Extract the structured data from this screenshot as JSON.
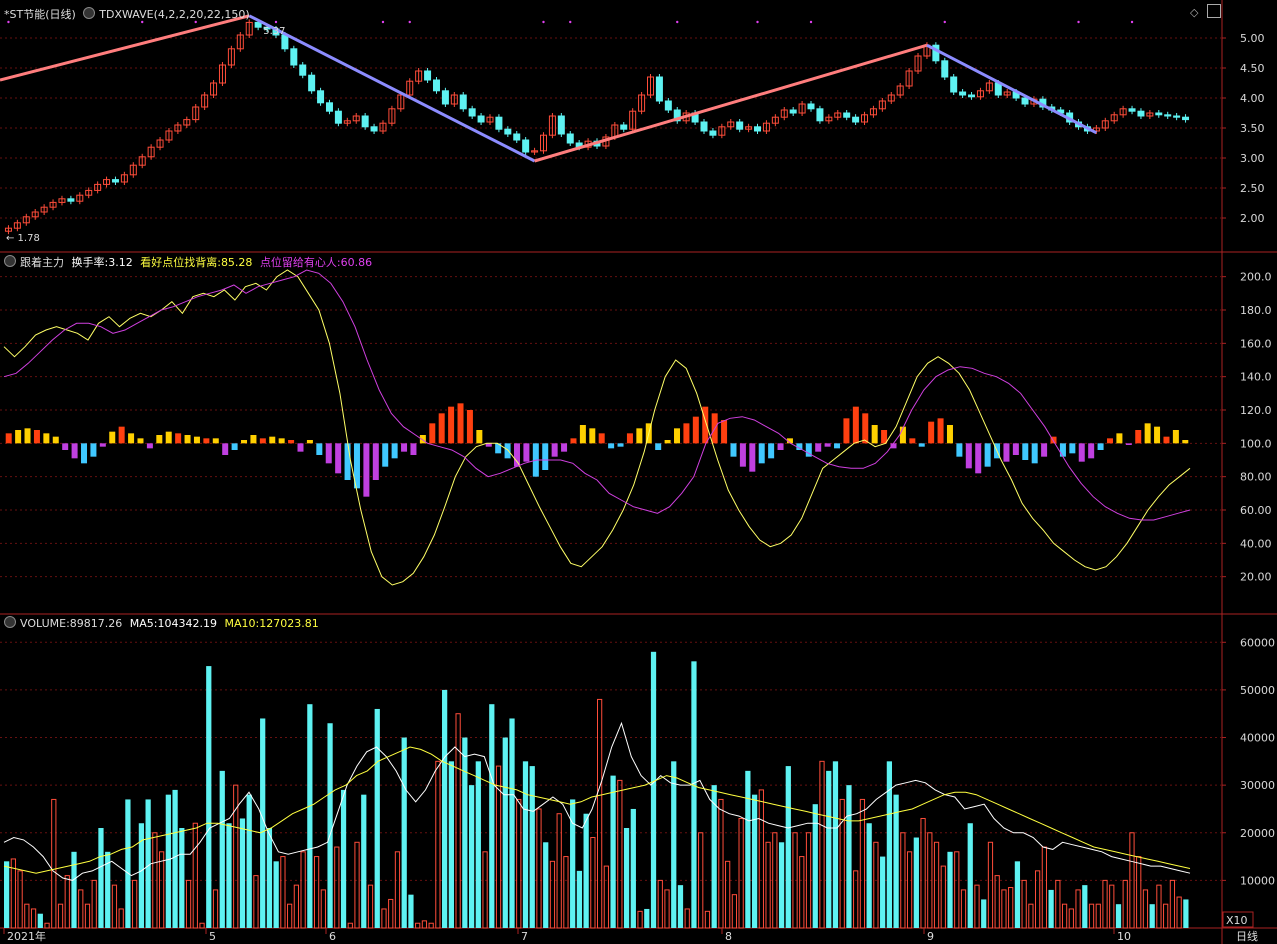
{
  "colors": {
    "up": "#ff4d3a",
    "down": "#5ef2f2",
    "ma5": "#ffffff",
    "ma10": "#ffff40",
    "wave_up": "#ff7d7d",
    "wave_down": "#8c8cff",
    "grid": "#661111",
    "frame": "#aa2222",
    "yellow_line": "#ffff66",
    "magenta_line": "#d040e0",
    "bar_orange": "#ff4010",
    "bar_yellow": "#ffd000",
    "bar_cyan": "#40c8ff",
    "bar_magenta": "#c040e0"
  },
  "panel1": {
    "title": "*ST节能(日线)",
    "indicator": "TDXWAVE(4,2,2,20,22,150)",
    "high_label": "5.37",
    "low_label": "1.78",
    "y_ticks": [
      "5.00",
      "4.50",
      "4.00",
      "3.50",
      "3.00",
      "2.50",
      "2.00"
    ]
  },
  "panel2": {
    "name": "跟着主力",
    "l1_name": "换手率:",
    "l1_value": "3.12",
    "l2_name": "看好点位找背离:",
    "l2_value": "85.28",
    "l3_name": "点位留给有心人:",
    "l3_value": "60.86",
    "y_ticks": [
      "200.0",
      "180.0",
      "160.0",
      "140.0",
      "120.0",
      "100.0",
      "80.00",
      "60.00",
      "40.00",
      "20.00"
    ]
  },
  "panel3": {
    "l1_name": "VOLUME:",
    "l1_value": "89817.26",
    "l2_name": "MA5:",
    "l2_value": "104342.19",
    "l3_name": "MA10:",
    "l3_value": "127023.81",
    "y_ticks": [
      "60000",
      "50000",
      "40000",
      "30000",
      "20000",
      "10000"
    ],
    "unit": "X10"
  },
  "x_labels": [
    "2021年",
    "5",
    "6",
    "7",
    "8",
    "9",
    "10"
  ],
  "period_label": "日线",
  "chart_data": [
    {
      "type": "candlestick",
      "title": "*ST节能(日线)",
      "ylim": [
        1.5,
        5.3
      ],
      "y_ticks": [
        2.0,
        2.5,
        3.0,
        3.5,
        4.0,
        4.5,
        5.0
      ],
      "wave_lines": [
        {
          "from": 1.78,
          "to": 5.37,
          "direction": "up"
        },
        {
          "from": 5.37,
          "to": 2.95,
          "direction": "down"
        },
        {
          "from": 2.95,
          "to": 4.88,
          "direction": "up"
        },
        {
          "from": 4.88,
          "to": 3.42,
          "direction": "down"
        }
      ],
      "annotations": [
        "5.37",
        "1.78"
      ],
      "close": [
        1.83,
        1.92,
        2.02,
        2.1,
        2.18,
        2.26,
        2.32,
        2.28,
        2.38,
        2.46,
        2.56,
        2.64,
        2.6,
        2.72,
        2.88,
        3.02,
        3.18,
        3.3,
        3.45,
        3.55,
        3.64,
        3.85,
        4.05,
        4.25,
        4.55,
        4.82,
        5.05,
        5.26,
        5.18,
        5.15,
        5.05,
        4.82,
        4.55,
        4.38,
        4.12,
        3.92,
        3.78,
        3.58,
        3.62,
        3.7,
        3.52,
        3.45,
        3.58,
        3.82,
        4.05,
        4.28,
        4.45,
        4.3,
        4.12,
        3.9,
        4.05,
        3.82,
        3.7,
        3.6,
        3.68,
        3.48,
        3.4,
        3.3,
        3.1,
        3.12,
        3.38,
        3.7,
        3.4,
        3.25,
        3.18,
        3.28,
        3.2,
        3.35,
        3.55,
        3.48,
        3.78,
        4.05,
        4.35,
        3.95,
        3.8,
        3.62,
        3.75,
        3.6,
        3.45,
        3.38,
        3.52,
        3.6,
        3.48,
        3.52,
        3.45,
        3.58,
        3.68,
        3.8,
        3.75,
        3.9,
        3.82,
        3.62,
        3.68,
        3.75,
        3.68,
        3.6,
        3.72,
        3.82,
        3.95,
        4.05,
        4.2,
        4.45,
        4.7,
        4.88,
        4.62,
        4.35,
        4.1,
        4.05,
        4.02,
        4.12,
        4.25,
        4.05,
        4.1,
        4.0,
        3.9,
        3.98,
        3.85,
        3.8,
        3.75,
        3.6,
        3.52,
        3.45,
        3.5,
        3.62,
        3.72,
        3.82,
        3.78,
        3.7,
        3.75,
        3.72,
        3.7,
        3.68,
        3.64
      ]
    },
    {
      "type": "bar",
      "title": "跟着主力",
      "ylim": [
        0,
        210
      ],
      "baseline": 100,
      "series": [
        {
          "name": "看好点位找背离",
          "values": [
            158,
            152,
            158,
            165,
            168,
            170,
            168,
            166,
            162,
            172,
            176,
            170,
            175,
            178,
            176,
            180,
            185,
            178,
            188,
            190,
            188,
            192,
            186,
            194,
            196,
            192,
            200,
            204,
            200,
            190,
            180,
            160,
            130,
            90,
            60,
            35,
            20,
            15,
            17,
            22,
            32,
            45,
            62,
            80,
            92,
            98,
            100,
            100,
            96,
            88,
            75,
            62,
            50,
            38,
            28,
            26,
            32,
            38,
            48,
            60,
            75,
            95,
            120,
            140,
            150,
            145,
            130,
            110,
            90,
            72,
            60,
            50,
            42,
            38,
            40,
            45,
            55,
            70,
            85,
            90,
            95,
            100,
            102,
            98,
            100,
            110,
            125,
            140,
            148,
            152,
            148,
            142,
            132,
            118,
            104,
            90,
            78,
            64,
            55,
            48,
            40,
            35,
            30,
            26,
            24,
            26,
            32,
            40,
            50,
            60,
            68,
            75,
            80,
            85
          ]
        },
        {
          "name": "点位留给有心人",
          "values": [
            140,
            142,
            148,
            155,
            162,
            168,
            172,
            172,
            170,
            166,
            168,
            172,
            176,
            180,
            182,
            185,
            188,
            190,
            192,
            195,
            190,
            194,
            196,
            198,
            200,
            204,
            202,
            196,
            185,
            170,
            150,
            132,
            118,
            110,
            105,
            100,
            98,
            96,
            92,
            85,
            80,
            82,
            85,
            88,
            90,
            90,
            90,
            88,
            82,
            78,
            70,
            66,
            62,
            60,
            58,
            62,
            70,
            80,
            100,
            112,
            115,
            116,
            114,
            110,
            106,
            100,
            96,
            92,
            88,
            86,
            85,
            85,
            88,
            95,
            105,
            120,
            132,
            140,
            144,
            146,
            145,
            142,
            140,
            136,
            130,
            120,
            110,
            98,
            86,
            76,
            68,
            62,
            58,
            55,
            54,
            54,
            56,
            58,
            60
          ]
        },
        {
          "name": "换手率",
          "values": [
            6,
            8,
            9,
            8,
            6,
            4,
            -4,
            -9,
            -12,
            -8,
            -2,
            7,
            10,
            6,
            3,
            -3,
            5,
            7,
            6,
            5,
            4,
            3,
            3,
            -7,
            -4,
            2,
            5,
            3,
            4,
            3,
            2,
            -5,
            2,
            -7,
            -12,
            -18,
            -22,
            -27,
            -32,
            -22,
            -14,
            -9,
            -5,
            -7,
            5,
            12,
            18,
            22,
            24,
            20,
            8,
            -2,
            -6,
            -9,
            -14,
            -11,
            -20,
            -16,
            -8,
            -5,
            3,
            11,
            9,
            6,
            -3,
            -2,
            6,
            9,
            12,
            -4,
            2,
            9,
            12,
            16,
            22,
            18,
            14,
            -8,
            -14,
            -17,
            -12,
            -9,
            -4,
            3,
            -4,
            -8,
            -5,
            -2,
            -3,
            15,
            22,
            18,
            11,
            8,
            -3,
            10,
            3,
            -2,
            13,
            15,
            11,
            -8,
            -15,
            -18,
            -14,
            -9,
            -11,
            -7,
            -10,
            -12,
            -8,
            4,
            -8,
            -6,
            -11,
            -9,
            -4,
            3,
            6,
            -1,
            8,
            12,
            10,
            4,
            8,
            2
          ]
        }
      ]
    },
    {
      "type": "bar",
      "title": "VOLUME",
      "ylim": [
        0,
        63000
      ],
      "series": [
        {
          "name": "VOLUME",
          "values": [
            14000,
            14500,
            12000,
            5000,
            4000,
            3000,
            1000,
            27000,
            5000,
            11000,
            16000,
            8000,
            5000,
            10000,
            21000,
            16000,
            9000,
            4000,
            27000,
            10000,
            22000,
            27000,
            20000,
            16000,
            28000,
            29000,
            21000,
            10000,
            22000,
            1000,
            55000,
            8000,
            33000,
            22000,
            30000,
            23000,
            28000,
            11000,
            44000,
            21000,
            14000,
            15000,
            5000,
            9000,
            16000,
            47000,
            15000,
            8000,
            43000,
            17000,
            29000,
            1000,
            18000,
            28000,
            9000,
            46000,
            4000,
            6000,
            16000,
            40000,
            7000,
            1000,
            1500,
            1000,
            35000,
            50000,
            35000,
            45000,
            40000,
            30000,
            35000,
            16000,
            47000,
            34000,
            40000,
            44000,
            27000,
            35000,
            34000,
            25000,
            18000,
            14000,
            24000,
            15000,
            27000,
            12000,
            24000,
            19000,
            48000,
            13000,
            32000,
            31000,
            21000,
            25000,
            3500,
            4000,
            58000,
            10000,
            8000,
            35000,
            9000,
            4000,
            56000,
            20000,
            3500,
            30000,
            27000,
            14000,
            7000,
            23000,
            33000,
            28000,
            29000,
            18000,
            20000,
            18000,
            34000,
            20000,
            15000,
            20000,
            26000,
            35000,
            33000,
            35000,
            27000,
            30000,
            12000,
            27000,
            22000,
            18000,
            15000,
            35000,
            28000,
            20000,
            16000,
            19000,
            23000,
            20000,
            18000,
            13000,
            16000,
            16000,
            8000,
            22000,
            9000,
            6000,
            18000,
            11000,
            8000,
            8500,
            14000,
            10000,
            5000,
            12000,
            17000,
            8000,
            10000,
            5000,
            4000,
            8000,
            9000,
            5000,
            5000,
            10000,
            9000,
            5000,
            10000,
            20000,
            15000,
            8000,
            5000,
            9000,
            5000,
            10000,
            6500,
            6000
          ]
        },
        {
          "name": "MA5",
          "values": [
            18000,
            19000,
            18500,
            17000,
            15000,
            12000,
            10500,
            10000,
            11500,
            12000,
            13000,
            14000,
            12500,
            11000,
            12000,
            13500,
            14000,
            14500,
            15500,
            15500,
            18000,
            21000,
            22000,
            23000,
            26000,
            28500,
            25000,
            20000,
            16000,
            15500,
            16000,
            16500,
            17000,
            18000,
            24000,
            30000,
            34000,
            37000,
            38000,
            36000,
            33000,
            29000,
            26500,
            29000,
            33000,
            36000,
            38000,
            36000,
            36500,
            36000,
            30000,
            28000,
            28000,
            25000,
            24500,
            26000,
            27500,
            26000,
            22000,
            21000,
            25000,
            31000,
            38000,
            43000,
            36000,
            32000,
            30000,
            32000,
            30500,
            30000,
            30000,
            31000,
            27000,
            25000,
            24000,
            23500,
            22500,
            23000,
            22000,
            21500,
            21000,
            21500,
            22000,
            22000,
            21000,
            21000,
            23500,
            24000,
            25000,
            27000,
            28500,
            30000,
            30500,
            31000,
            30500,
            29000,
            28000,
            27500,
            25000,
            25500,
            26000,
            23000,
            21000,
            20000,
            20000,
            19000,
            17000,
            16500,
            18000,
            17500,
            17000,
            16500,
            16000,
            15000,
            14500,
            14000,
            13500,
            13000,
            13000,
            12500,
            12000,
            11500
          ]
        },
        {
          "name": "MA10",
          "values": [
            13000,
            12500,
            12000,
            11500,
            12000,
            12500,
            13000,
            13500,
            14000,
            15000,
            15500,
            16500,
            17000,
            18500,
            19000,
            19500,
            20000,
            20500,
            21000,
            22000,
            22000,
            21500,
            21000,
            20500,
            20000,
            21000,
            22500,
            24000,
            25000,
            26000,
            27500,
            29000,
            30000,
            32000,
            33000,
            35000,
            36000,
            37000,
            38000,
            37500,
            36500,
            35000,
            34000,
            33000,
            32000,
            31000,
            30000,
            29500,
            29000,
            28000,
            27500,
            27000,
            26500,
            26000,
            26500,
            27500,
            28000,
            28500,
            29000,
            29500,
            30000,
            31000,
            32000,
            31500,
            30500,
            29500,
            29000,
            28500,
            28000,
            27500,
            27000,
            26500,
            26000,
            25500,
            25000,
            24500,
            24000,
            23500,
            23000,
            22500,
            22500,
            23000,
            23500,
            24000,
            24500,
            25000,
            26000,
            27000,
            28000,
            28500,
            28500,
            28000,
            27000,
            26000,
            25000,
            24000,
            23000,
            22000,
            21000,
            20000,
            19000,
            18000,
            17000,
            16500,
            16000,
            15500,
            15000,
            14500,
            14000,
            13500,
            13000,
            12500
          ]
        }
      ]
    }
  ]
}
